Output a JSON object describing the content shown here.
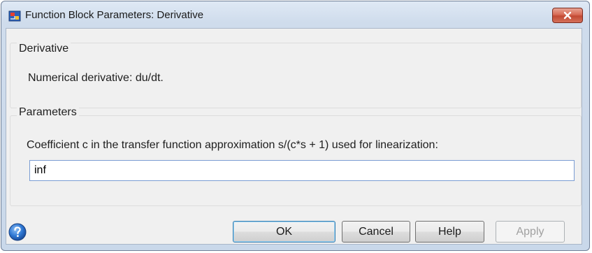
{
  "window": {
    "title": "Function Block Parameters: Derivative",
    "icon": "simulink-block-icon",
    "close_icon": "close-icon"
  },
  "derivative_group": {
    "label": "Derivative",
    "description": "Numerical derivative:  du/dt."
  },
  "parameters_group": {
    "label": "Parameters",
    "coefficient_label": "Coefficient c in the transfer function approximation s/(c*s + 1) used for linearization:",
    "coefficient_value": "inf"
  },
  "buttons": {
    "help_icon": "help-icon",
    "ok_label": "OK",
    "cancel_label": "Cancel",
    "help_label": "Help",
    "apply_label": "Apply",
    "apply_enabled": false
  },
  "colors": {
    "window_frame": "#c9d8ea",
    "client_background": "#f0f0f0",
    "close_button": "#c24a33",
    "default_button_border": "#3c7fb1"
  }
}
